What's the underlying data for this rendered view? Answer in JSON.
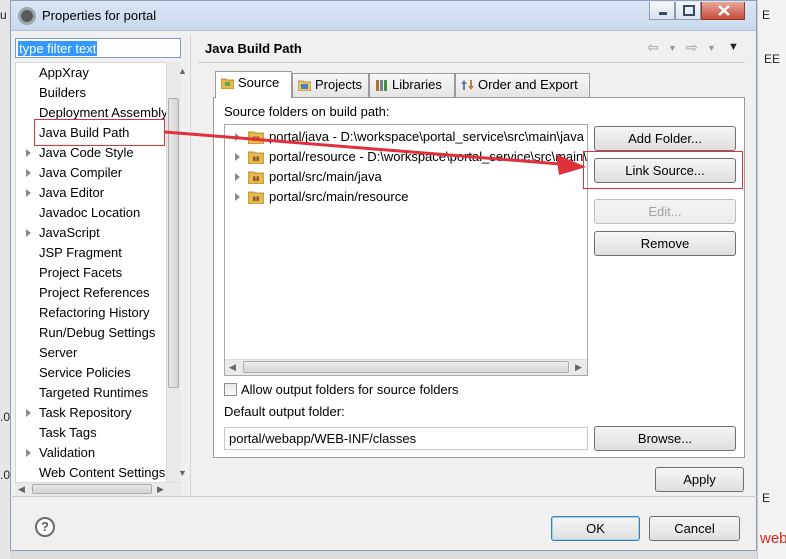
{
  "window": {
    "title": "Properties for portal",
    "background_fragments": [
      "E",
      "EE",
      "web",
      "u",
      ".0",
      ".0",
      "E"
    ]
  },
  "sidebar": {
    "filter_placeholder": "type filter text",
    "items": [
      {
        "label": "AppXray",
        "expandable": false
      },
      {
        "label": "Builders",
        "expandable": false
      },
      {
        "label": "Deployment Assembly",
        "expandable": false
      },
      {
        "label": "Java Build Path",
        "expandable": false,
        "highlighted": true
      },
      {
        "label": "Java Code Style",
        "expandable": true
      },
      {
        "label": "Java Compiler",
        "expandable": true
      },
      {
        "label": "Java Editor",
        "expandable": true
      },
      {
        "label": "Javadoc Location",
        "expandable": false
      },
      {
        "label": "JavaScript",
        "expandable": true
      },
      {
        "label": "JSP Fragment",
        "expandable": false
      },
      {
        "label": "Project Facets",
        "expandable": false
      },
      {
        "label": "Project References",
        "expandable": false
      },
      {
        "label": "Refactoring History",
        "expandable": false
      },
      {
        "label": "Run/Debug Settings",
        "expandable": false
      },
      {
        "label": "Server",
        "expandable": false
      },
      {
        "label": "Service Policies",
        "expandable": false
      },
      {
        "label": "Targeted Runtimes",
        "expandable": false
      },
      {
        "label": "Task Repository",
        "expandable": true
      },
      {
        "label": "Task Tags",
        "expandable": false
      },
      {
        "label": "Validation",
        "expandable": true
      },
      {
        "label": "Web Content Settings",
        "expandable": false
      }
    ]
  },
  "page": {
    "title": "Java Build Path",
    "tabs": [
      {
        "label": "Source",
        "icon": "source-folder-icon",
        "active": true
      },
      {
        "label": "Projects",
        "icon": "projects-icon",
        "active": false
      },
      {
        "label": "Libraries",
        "icon": "libraries-icon",
        "active": false
      },
      {
        "label": "Order and Export",
        "icon": "order-export-icon",
        "active": false
      }
    ],
    "source_label": "Source folders on build path:",
    "source_folders": [
      "portal/java - D:\\workspace\\portal_service\\src\\main\\java",
      "portal/resource - D:\\workspace\\portal_service\\src\\main\\resource",
      "portal/src/main/java",
      "portal/src/main/resource"
    ],
    "buttons": {
      "add_folder": "Add Folder...",
      "link_source": "Link Source...",
      "edit": "Edit...",
      "remove": "Remove",
      "browse": "Browse..."
    },
    "allow_output_label": "Allow output folders for source folders",
    "allow_output_checked": false,
    "default_output_label": "Default output folder:",
    "default_output_value": "portal/webapp/WEB-INF/classes"
  },
  "footer": {
    "apply": "Apply",
    "ok": "OK",
    "cancel": "Cancel"
  },
  "colors": {
    "annotation_red": "#e0303a",
    "selection_blue": "#3399ff"
  }
}
